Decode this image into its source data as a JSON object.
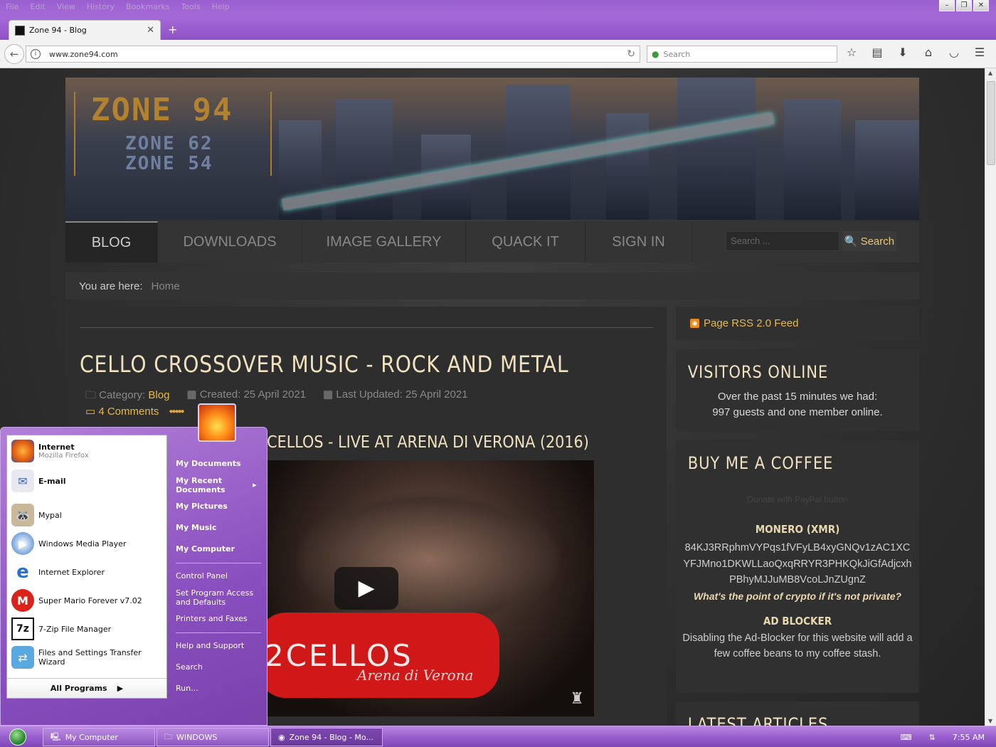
{
  "browser": {
    "menu": [
      "File",
      "Edit",
      "View",
      "History",
      "Bookmarks",
      "Tools",
      "Help"
    ],
    "tab_title": "Zone 94 - Blog",
    "url": "www.zone94.com",
    "search_placeholder": "Search"
  },
  "site": {
    "logo": {
      "main": "ZONE 94",
      "sub1": "ZONE 62",
      "sub2": "ZONE 54"
    },
    "nav": [
      "BLOG",
      "DOWNLOADS",
      "IMAGE GALLERY",
      "QUACK IT",
      "SIGN IN"
    ],
    "search_placeholder": "Search ...",
    "search_button": "Search",
    "breadcrumb": {
      "label": "You are here:",
      "home": "Home"
    },
    "article": {
      "title": "CELLO CROSSOVER MUSIC - ROCK AND METAL",
      "category_label": "Category:",
      "category": "Blog",
      "created": "Created: 25 April 2021",
      "updated": "Last Updated: 25 April 2021",
      "comments": "4 Comments",
      "subtitle": "2CELLOS - LIVE AT ARENA DI VERONA (2016)",
      "video_title": "2CELLOS",
      "video_sub": "Arena di Verona"
    },
    "sidebar": {
      "rss": "Page RSS 2.0 Feed",
      "visitors_title": "VISITORS ONLINE",
      "visitors_text1": "Over the past 15 minutes we had:",
      "visitors_text2": "997 guests and one member online.",
      "coffee_title": "BUY ME A COFFEE",
      "donate": "Donate with PayPal button",
      "monero_title": "MONERO (XMR)",
      "monero_addr1": "84KJ3RRphmVYPqs1fVFyLB4xyGNQv1zAC1XC",
      "monero_addr2": "YFJMno1DKWLLaoQxqRRYR3PHKQkJiGfAdjcxh",
      "monero_addr3": "PBhyMJJuMB8VcoLJnZUgnZ",
      "crypto_q": "What's the point of crypto if it's not private?",
      "adblock_title": "AD BLOCKER",
      "adblock_text": "Disabling the Ad-Blocker for this website will add a few coffee beans to my coffee stash.",
      "latest_title": "LATEST ARTICLES"
    }
  },
  "startmenu": {
    "left": [
      {
        "name": "Internet",
        "sub": "Mozilla Firefox",
        "icon": "firefox-icon",
        "bold": true
      },
      {
        "name": "E-mail",
        "sub": "",
        "icon": "email-icon",
        "bold": true
      },
      {
        "name": "Mypal",
        "sub": "",
        "icon": "mypal-icon",
        "bold": false
      },
      {
        "name": "Windows Media Player",
        "sub": "",
        "icon": "media-player-icon",
        "bold": false
      },
      {
        "name": "Internet Explorer",
        "sub": "",
        "icon": "ie-icon",
        "bold": false
      },
      {
        "name": "Super Mario Forever v7.02",
        "sub": "",
        "icon": "mario-icon",
        "bold": false
      },
      {
        "name": "7-Zip File Manager",
        "sub": "",
        "icon": "7zip-icon",
        "bold": false
      },
      {
        "name": "Files and Settings Transfer Wizard",
        "sub": "",
        "icon": "transfer-wizard-icon",
        "bold": false
      }
    ],
    "all_programs": "All Programs",
    "right": {
      "my_documents": "My Documents",
      "my_recent": "My Recent Documents",
      "my_pictures": "My Pictures",
      "my_music": "My Music",
      "my_computer": "My Computer",
      "control_panel": "Control Panel",
      "set_program": "Set Program Access and Defaults",
      "printers": "Printers and Faxes",
      "help": "Help and Support",
      "search": "Search",
      "run": "Run..."
    }
  },
  "taskbar": {
    "tasks": [
      "My Computer",
      "WINDOWS",
      "Zone 94 - Blog - Mo..."
    ],
    "clock": "7:55 AM"
  },
  "colors": {
    "accent_gold": "#e4b94f",
    "titlebar_purple": "#9a5fcf",
    "heading": "#f0e2c0"
  }
}
